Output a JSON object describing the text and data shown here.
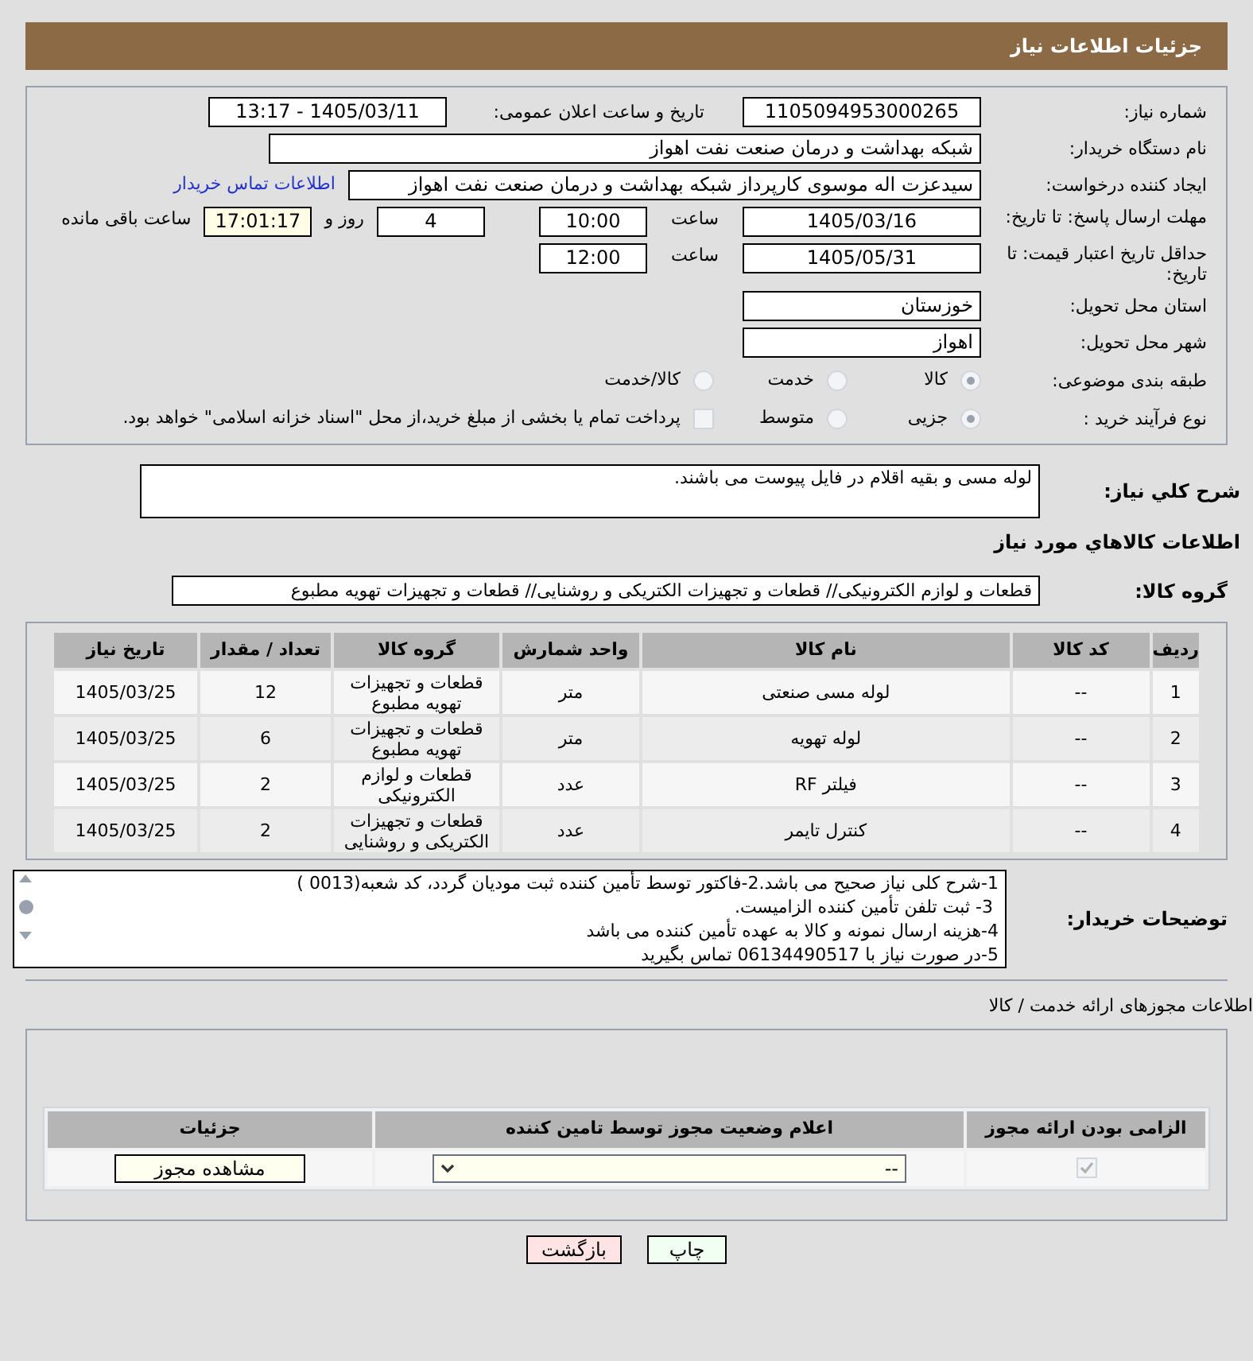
{
  "header": {
    "title": "جزئیات اطلاعات نیاز"
  },
  "need_number": {
    "label": "شماره نیاز:",
    "value": "1105094953000265"
  },
  "announce": {
    "label": "تاریخ و ساعت اعلان عمومی:",
    "value": "1405/03/11 - 13:17"
  },
  "buyer_org": {
    "label": "نام دستگاه خریدار:",
    "value": "شبکه بهداشت و درمان صنعت نفت اهواز"
  },
  "requester": {
    "label": "ایجاد کننده درخواست:",
    "value": "سیدعزت اله موسوی کارپرداز شبکه بهداشت و درمان صنعت نفت اهواز",
    "link": "اطلاعات تماس خریدار"
  },
  "deadline": {
    "label": "مهلت ارسال پاسخ: تا تاریخ:",
    "date": "1405/03/16",
    "time_label": "ساعت",
    "time": "10:00",
    "days": "4",
    "days_label": "روز و",
    "remaining": "17:01:17",
    "remaining_label": "ساعت باقی مانده"
  },
  "validity": {
    "label": "حداقل تاریخ اعتبار قیمت: تا تاریخ:",
    "date": "1405/05/31",
    "time_label": "ساعت",
    "time": "12:00"
  },
  "province": {
    "label": "استان محل تحویل:",
    "value": "خوزستان"
  },
  "city": {
    "label": "شهر محل تحویل:",
    "value": "اهواز"
  },
  "category": {
    "label": "طبقه بندی موضوعی:",
    "options": [
      {
        "label": "کالا",
        "selected": true
      },
      {
        "label": "خدمت",
        "selected": false
      },
      {
        "label": "کالا/خدمت",
        "selected": false
      }
    ]
  },
  "process": {
    "label": "نوع فرآیند خرید :",
    "options": [
      {
        "label": "جزیی",
        "selected": true
      },
      {
        "label": "متوسط",
        "selected": false
      }
    ],
    "checkbox": {
      "label": "پرداخت تمام یا بخشی از مبلغ خرید،از محل \"اسناد خزانه اسلامی\" خواهد بود.",
      "checked": false
    }
  },
  "description": {
    "label": "شرح کلي نياز:",
    "value": "لوله مسی و بقیه اقلام در فایل پیوست می باشند."
  },
  "goods_title": "اطلاعات کالاهاي مورد نياز",
  "group": {
    "label": "گروه کالا:",
    "value": "قطعات و لوازم الکترونیکی// قطعات و تجهیزات الکتریکی و روشنایی//  قطعات و تجهیزات تهویه مطبوع"
  },
  "table": {
    "columns": [
      "ردیف",
      "کد کالا",
      "نام کالا",
      "واحد شمارش",
      "گروه کالا",
      "تعداد / مقدار",
      "تاریخ نیاز"
    ],
    "rows": [
      [
        "1",
        "--",
        "لوله مسی صنعتی",
        "متر",
        "قطعات و تجهیزات تهویه مطبوع",
        "12",
        "1405/03/25"
      ],
      [
        "2",
        "--",
        "لوله تهویه",
        "متر",
        "قطعات و تجهیزات تهویه مطبوع",
        "6",
        "1405/03/25"
      ],
      [
        "3",
        "--",
        "فیلتر RF",
        "عدد",
        "قطعات و لوازم الکترونیکی",
        "2",
        "1405/03/25"
      ],
      [
        "4",
        "--",
        "کنترل تایمر",
        "عدد",
        "قطعات و تجهیزات الکتریکی و روشنایی",
        "2",
        "1405/03/25"
      ]
    ]
  },
  "buyer_notes": {
    "label": "توضیحات خریدار:",
    "lines": [
      "1-شرح کلی نیاز صحیح می باشد.2-فاکتور توسط تأمین کننده ثبت مودیان گردد، کد شعبه(0013 )",
      " 3- ثبت تلفن تأمین کننده الزامیست.",
      "4-هزینه ارسال نمونه و کالا به عهده تأمین کننده می باشد",
      "5-در صورت نیاز با 06134490517 تماس بگیرید"
    ]
  },
  "permits": {
    "title": "اطلاعات مجوزهای ارائه خدمت / کالا",
    "columns": [
      "الزامی بودن ارائه مجوز",
      "اعلام وضعیت مجوز توسط تامین کننده",
      "جزئیات"
    ],
    "rows": [
      {
        "required": true,
        "status": "--",
        "button": "مشاهده مجوز"
      }
    ]
  },
  "buttons": [
    {
      "label": "چاپ",
      "kind": "print"
    },
    {
      "label": "بازگشت",
      "kind": "back"
    }
  ]
}
